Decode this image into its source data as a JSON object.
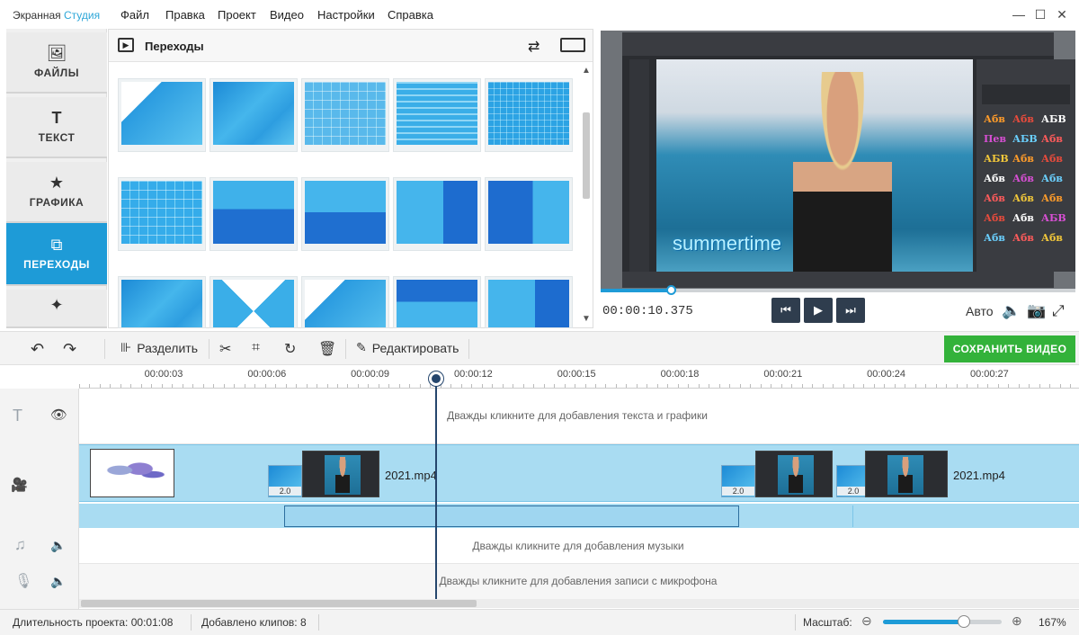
{
  "app": {
    "title_main": "Экранная ",
    "title_accent": "Студия"
  },
  "menu": [
    "Файл",
    "Правка",
    "Проект",
    "Видео",
    "Настройки",
    "Справка"
  ],
  "left_tabs": [
    {
      "label": "ФАЙЛЫ",
      "icon": "image-icon"
    },
    {
      "label": "ТЕКСТ",
      "icon": "text-t-icon"
    },
    {
      "label": "ГРАФИКА",
      "icon": "star-icon"
    },
    {
      "label": "ПЕРЕХОДЫ",
      "icon": "transitions-icon",
      "active": true
    },
    {
      "label": "",
      "icon": "magic-wand-icon"
    }
  ],
  "transitions": {
    "title": "Переходы",
    "items": [
      "wipe-diagonal",
      "arrow-left",
      "fade-dots",
      "lines-down",
      "mosaic",
      "grid",
      "split-down",
      "split-up",
      "slide-left",
      "slide-right",
      "corner-sweep",
      "clock",
      "corner-peel",
      "bar-down",
      "slide-left-2"
    ]
  },
  "preview": {
    "overlay_text": "summertime",
    "styles": [
      "Абв",
      "Абв",
      "АБВ",
      "Пев",
      "АБВ",
      "Абв",
      "АБВ",
      "Абв",
      "Абв",
      "Абв",
      "Абв",
      "Абв",
      "Абв",
      "Абв",
      "Абв",
      "Абв",
      "Абв",
      "АБВ",
      "Абв",
      "Абв",
      "Абв"
    ],
    "progress": 0.15,
    "timecode": "00:00:10.375",
    "quality": "Авто"
  },
  "toolbar": {
    "split_label": "Разделить",
    "edit_label": "Редактировать",
    "save_label": "СОХРАНИТЬ ВИДЕО"
  },
  "timeline": {
    "ticks": [
      "00:00:03",
      "00:00:06",
      "00:00:09",
      "00:00:12",
      "00:00:15",
      "00:00:18",
      "00:00:21",
      "00:00:24",
      "00:00:27"
    ],
    "text_hint": "Дважды кликните для добавления текста и графики",
    "music_hint": "Дважды кликните для добавления музыки",
    "mic_hint": "Дважды кликните для добавления записи с микрофона",
    "clip1_name": "2021.mp4",
    "clip2_name": "2021.mp4",
    "trans_duration": "2.0"
  },
  "status": {
    "duration_label": "Длительность проекта:",
    "duration_value": "00:01:08",
    "clips_label": "Добавлено клипов:",
    "clips_value": "8",
    "zoom_label": "Масштаб:",
    "zoom_value": "167%",
    "zoom_level": 0.68
  },
  "colors": {
    "accent": "#1e9bd7",
    "save_green": "#33b23a",
    "playhead": "#25466d"
  }
}
